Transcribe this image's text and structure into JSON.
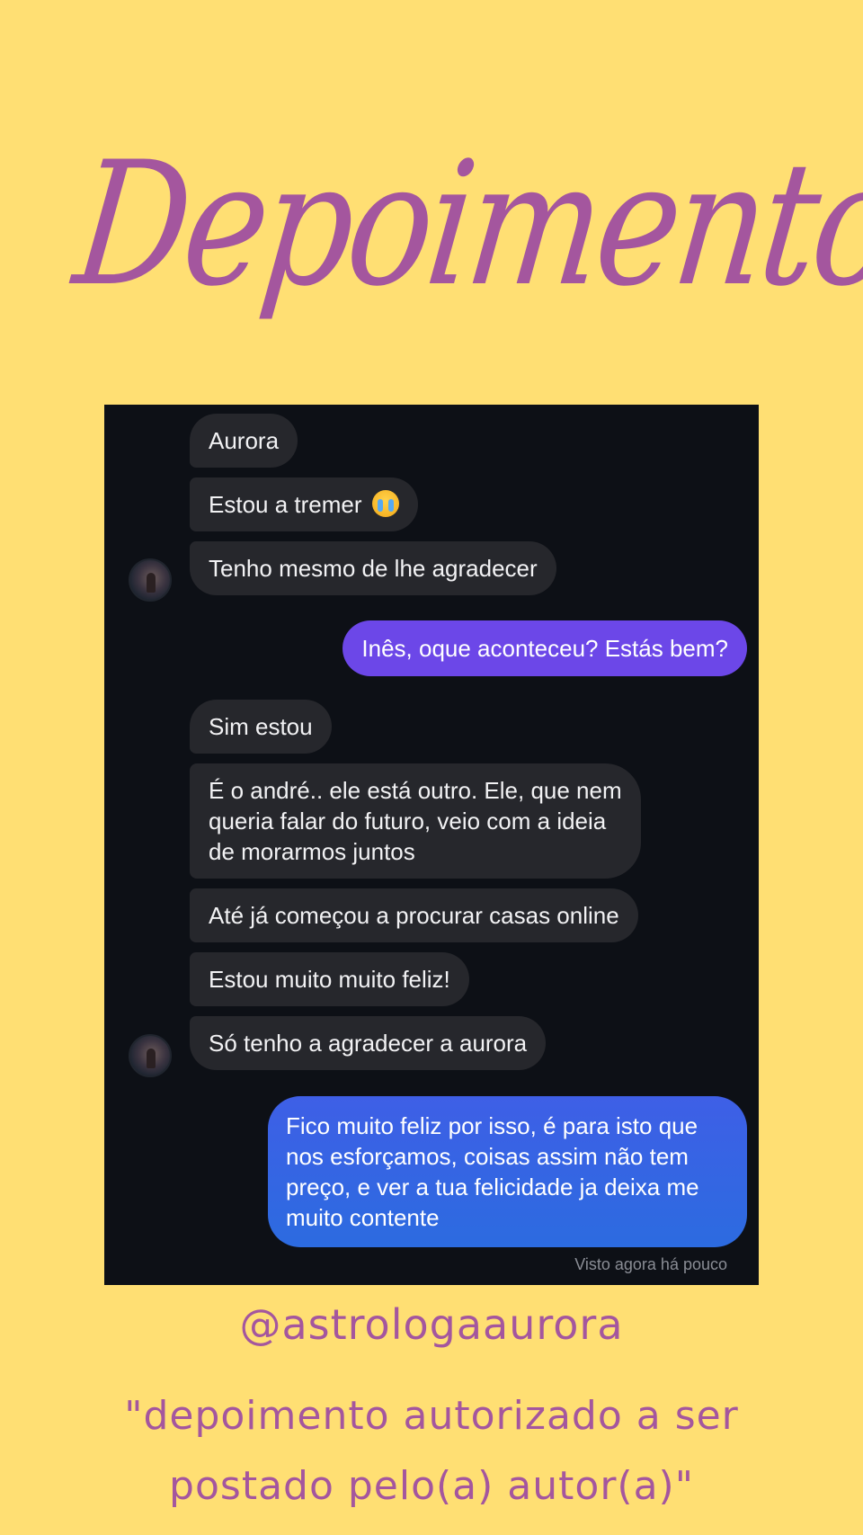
{
  "title": "Depoimentos",
  "chat": {
    "messages": [
      {
        "text": "Aurora"
      },
      {
        "text": "Estou a tremer",
        "emoji": "loudly-crying-face"
      },
      {
        "text": "Tenho mesmo de lhe agradecer"
      },
      {
        "text": "Inês, oque aconteceu? Estás bem?"
      },
      {
        "text": "Sim estou"
      },
      {
        "line1": "É o andré.. ele está outro. Ele, que nem",
        "line2": "queria falar do futuro, veio com a ideia",
        "line3": "de morarmos juntos"
      },
      {
        "text": "Até já começou a procurar casas online"
      },
      {
        "text": "Estou muito muito feliz!"
      },
      {
        "text": "Só tenho a agradecer a aurora"
      },
      {
        "line1": "Fico muito feliz por isso, é para isto que",
        "line2": "nos esforçamos, coisas assim não tem",
        "line3": "preço, e ver a tua felicidade ja deixa me",
        "line4": "muito contente"
      }
    ],
    "seen_status": "Visto agora há pouco"
  },
  "handle": "@astrologaaurora",
  "quote": {
    "line1": "\"depoimento autorizado a ser",
    "line2": "postado pelo(a) autor(a)\""
  },
  "colors": {
    "background": "#FFDF73",
    "accent": "#A4569E",
    "chat_background": "#0D1016",
    "incoming_bubble": "#26272C",
    "outgoing_purple": "#6C47E8",
    "outgoing_blue": "#2F63E6"
  }
}
